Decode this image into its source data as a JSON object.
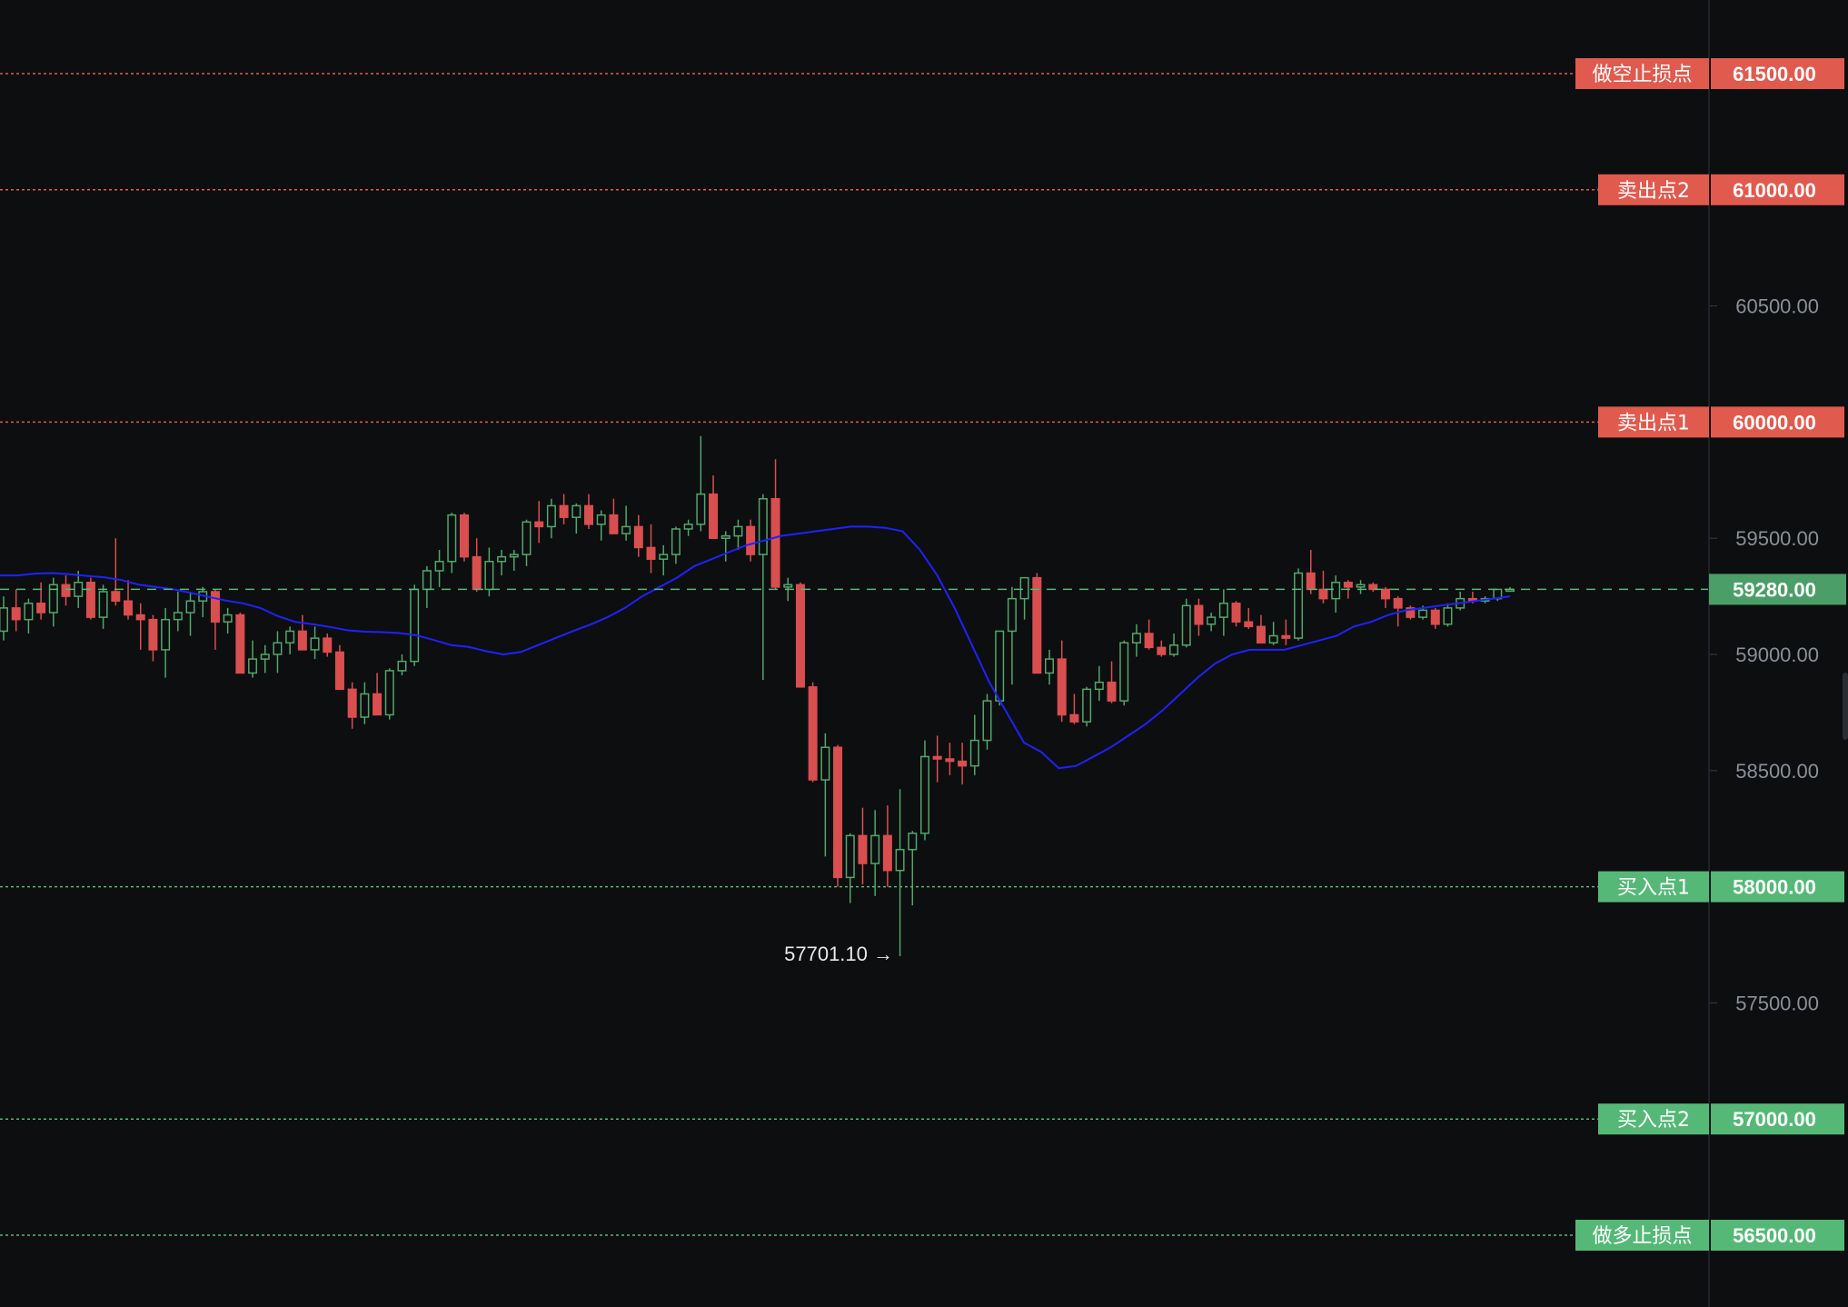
{
  "colors": {
    "background": "#0d0e10",
    "up": "#52a66a",
    "down": "#d94f4f",
    "ma": "#1f22ff",
    "axis_text": "#8b8f97",
    "resistance": "#e05a4e",
    "support": "#55b877"
  },
  "chart_data": {
    "type": "candlestick",
    "ylim": [
      56250,
      61700
    ],
    "y_ticks": [
      "60500.00",
      "59500.00",
      "59000.00",
      "58500.00",
      "57500.00"
    ],
    "grid": false,
    "current_price": {
      "value": 59280,
      "label": "59280.00"
    },
    "low_annotation": {
      "value": 57701.1,
      "label": "57701.10 →"
    },
    "levels": [
      {
        "name": "做空止损点",
        "price": 61500,
        "price_label": "61500.00",
        "kind": "resistance"
      },
      {
        "name": "卖出点2",
        "price": 61000,
        "price_label": "61000.00",
        "kind": "resistance"
      },
      {
        "name": "卖出点1",
        "price": 60000,
        "price_label": "60000.00",
        "kind": "resistance"
      },
      {
        "name": "买入点1",
        "price": 58000,
        "price_label": "58000.00",
        "kind": "support"
      },
      {
        "name": "买入点2",
        "price": 57000,
        "price_label": "57000.00",
        "kind": "support"
      },
      {
        "name": "做多止损点",
        "price": 56500,
        "price_label": "56500.00",
        "kind": "support"
      }
    ],
    "candles": [
      [
        59100,
        59250,
        59060,
        59200
      ],
      [
        59200,
        59280,
        59100,
        59150
      ],
      [
        59150,
        59240,
        59090,
        59220
      ],
      [
        59220,
        59310,
        59150,
        59180
      ],
      [
        59180,
        59330,
        59120,
        59300
      ],
      [
        59300,
        59340,
        59210,
        59250
      ],
      [
        59250,
        59360,
        59200,
        59310
      ],
      [
        59310,
        59330,
        59150,
        59160
      ],
      [
        59160,
        59300,
        59110,
        59270
      ],
      [
        59270,
        59500,
        59210,
        59230
      ],
      [
        59230,
        59320,
        59150,
        59170
      ],
      [
        59170,
        59220,
        59020,
        59150
      ],
      [
        59150,
        59170,
        58970,
        59020
      ],
      [
        59020,
        59200,
        58900,
        59150
      ],
      [
        59150,
        59270,
        59100,
        59180
      ],
      [
        59180,
        59270,
        59080,
        59230
      ],
      [
        59230,
        59290,
        59160,
        59270
      ],
      [
        59270,
        59280,
        59020,
        59140
      ],
      [
        59140,
        59200,
        59090,
        59170
      ],
      [
        59170,
        59180,
        58920,
        58920
      ],
      [
        58920,
        59060,
        58900,
        58980
      ],
      [
        58980,
        59040,
        58920,
        59000
      ],
      [
        59000,
        59100,
        58920,
        59050
      ],
      [
        59050,
        59120,
        59000,
        59100
      ],
      [
        59100,
        59170,
        59020,
        59020
      ],
      [
        59020,
        59120,
        58980,
        59070
      ],
      [
        59070,
        59090,
        58990,
        59010
      ],
      [
        59010,
        59040,
        58850,
        58850
      ],
      [
        58850,
        58880,
        58680,
        58730
      ],
      [
        58730,
        58880,
        58700,
        58830
      ],
      [
        58830,
        58920,
        58760,
        58740
      ],
      [
        58740,
        58940,
        58720,
        58930
      ],
      [
        58930,
        59000,
        58910,
        58970
      ],
      [
        58970,
        59300,
        58950,
        59280
      ],
      [
        59280,
        59380,
        59200,
        59360
      ],
      [
        59360,
        59450,
        59290,
        59400
      ],
      [
        59400,
        59610,
        59350,
        59600
      ],
      [
        59600,
        59610,
        59400,
        59420
      ],
      [
        59420,
        59500,
        59270,
        59280
      ],
      [
        59280,
        59460,
        59250,
        59400
      ],
      [
        59400,
        59450,
        59340,
        59420
      ],
      [
        59420,
        59450,
        59360,
        59430
      ],
      [
        59430,
        59580,
        59380,
        59570
      ],
      [
        59570,
        59660,
        59480,
        59550
      ],
      [
        59550,
        59670,
        59500,
        59640
      ],
      [
        59640,
        59690,
        59560,
        59590
      ],
      [
        59590,
        59650,
        59520,
        59640
      ],
      [
        59640,
        59690,
        59540,
        59560
      ],
      [
        59560,
        59620,
        59490,
        59600
      ],
      [
        59600,
        59670,
        59550,
        59520
      ],
      [
        59520,
        59640,
        59490,
        59550
      ],
      [
        59550,
        59600,
        59420,
        59460
      ],
      [
        59460,
        59560,
        59350,
        59410
      ],
      [
        59410,
        59470,
        59340,
        59430
      ],
      [
        59430,
        59550,
        59390,
        59540
      ],
      [
        59540,
        59580,
        59510,
        59560
      ],
      [
        59560,
        59940,
        59530,
        59690
      ],
      [
        59690,
        59770,
        59500,
        59500
      ],
      [
        59500,
        59530,
        59400,
        59510
      ],
      [
        59510,
        59580,
        59450,
        59550
      ],
      [
        59550,
        59580,
        59400,
        59430
      ],
      [
        59430,
        59690,
        58890,
        59670
      ],
      [
        59670,
        59840,
        59280,
        59290
      ],
      [
        59290,
        59330,
        59230,
        59300
      ],
      [
        59300,
        59310,
        58860,
        58860
      ],
      [
        58860,
        58880,
        58450,
        58460
      ],
      [
        58460,
        58660,
        58130,
        58600
      ],
      [
        58600,
        58610,
        58000,
        58040
      ],
      [
        58040,
        58230,
        57930,
        58220
      ],
      [
        58220,
        58340,
        58010,
        58100
      ],
      [
        58100,
        58330,
        57960,
        58220
      ],
      [
        58220,
        58350,
        58000,
        58070
      ],
      [
        58070,
        58420,
        57701.1,
        58160
      ],
      [
        58160,
        58240,
        57920,
        58230
      ],
      [
        58230,
        58630,
        58200,
        58560
      ],
      [
        58560,
        58650,
        58450,
        58550
      ],
      [
        58550,
        58620,
        58480,
        58540
      ],
      [
        58540,
        58620,
        58440,
        58520
      ],
      [
        58520,
        58740,
        58480,
        58630
      ],
      [
        58630,
        58830,
        58590,
        58800
      ],
      [
        58800,
        59000,
        58780,
        59100
      ],
      [
        59100,
        59290,
        58870,
        59240
      ],
      [
        59240,
        59330,
        59150,
        59330
      ],
      [
        59330,
        59350,
        58980,
        58920
      ],
      [
        58920,
        59020,
        58870,
        58980
      ],
      [
        58980,
        59060,
        58710,
        58740
      ],
      [
        58740,
        58830,
        58700,
        58710
      ],
      [
        58710,
        58860,
        58690,
        58850
      ],
      [
        58850,
        58950,
        58800,
        58880
      ],
      [
        58880,
        58970,
        58790,
        58800
      ],
      [
        58800,
        59060,
        58780,
        59050
      ],
      [
        59050,
        59130,
        58990,
        59090
      ],
      [
        59090,
        59150,
        59020,
        59030
      ],
      [
        59030,
        59060,
        58990,
        59000
      ],
      [
        59000,
        59090,
        58990,
        59040
      ],
      [
        59040,
        59240,
        59030,
        59210
      ],
      [
        59210,
        59240,
        59080,
        59130
      ],
      [
        59130,
        59180,
        59100,
        59160
      ],
      [
        59160,
        59280,
        59080,
        59220
      ],
      [
        59220,
        59230,
        59120,
        59140
      ],
      [
        59140,
        59200,
        59110,
        59120
      ],
      [
        59120,
        59170,
        59060,
        59050
      ],
      [
        59050,
        59140,
        59040,
        59080
      ],
      [
        59080,
        59150,
        59040,
        59070
      ],
      [
        59070,
        59370,
        59060,
        59350
      ],
      [
        59350,
        59450,
        59260,
        59280
      ],
      [
        59280,
        59360,
        59220,
        59240
      ],
      [
        59240,
        59340,
        59180,
        59310
      ],
      [
        59310,
        59320,
        59240,
        59290
      ],
      [
        59290,
        59320,
        59260,
        59300
      ],
      [
        59300,
        59310,
        59270,
        59280
      ],
      [
        59280,
        59290,
        59200,
        59240
      ],
      [
        59240,
        59250,
        59120,
        59200
      ],
      [
        59200,
        59210,
        59150,
        59160
      ],
      [
        59160,
        59210,
        59150,
        59190
      ],
      [
        59190,
        59200,
        59110,
        59130
      ],
      [
        59130,
        59220,
        59120,
        59200
      ],
      [
        59200,
        59270,
        59190,
        59240
      ],
      [
        59240,
        59270,
        59220,
        59230
      ],
      [
        59230,
        59250,
        59220,
        59240
      ],
      [
        59240,
        59280,
        59230,
        59280
      ],
      [
        59280,
        59290,
        59270,
        59280
      ]
    ],
    "moving_average": [
      59340,
      59340,
      59348,
      59350,
      59345,
      59338,
      59332,
      59320,
      59300,
      59290,
      59280,
      59265,
      59248,
      59232,
      59220,
      59200,
      59165,
      59140,
      59130,
      59118,
      59104,
      59098,
      59096,
      59092,
      59082,
      59062,
      59040,
      59032,
      59014,
      59000,
      59010,
      59040,
      59070,
      59100,
      59128,
      59160,
      59200,
      59250,
      59290,
      59330,
      59380,
      59410,
      59440,
      59470,
      59490,
      59510,
      59520,
      59530,
      59540,
      59550,
      59550,
      59545,
      59530,
      59450,
      59340,
      59200,
      59040,
      58880,
      58750,
      58620,
      58580,
      58510,
      58520,
      58560,
      58600,
      58650,
      58700,
      58760,
      58830,
      58900,
      58960,
      59000,
      59020,
      59020,
      59020,
      59040,
      59060,
      59080,
      59120,
      59140,
      59170,
      59190,
      59200,
      59210,
      59220,
      59230,
      59240,
      59250
    ]
  }
}
